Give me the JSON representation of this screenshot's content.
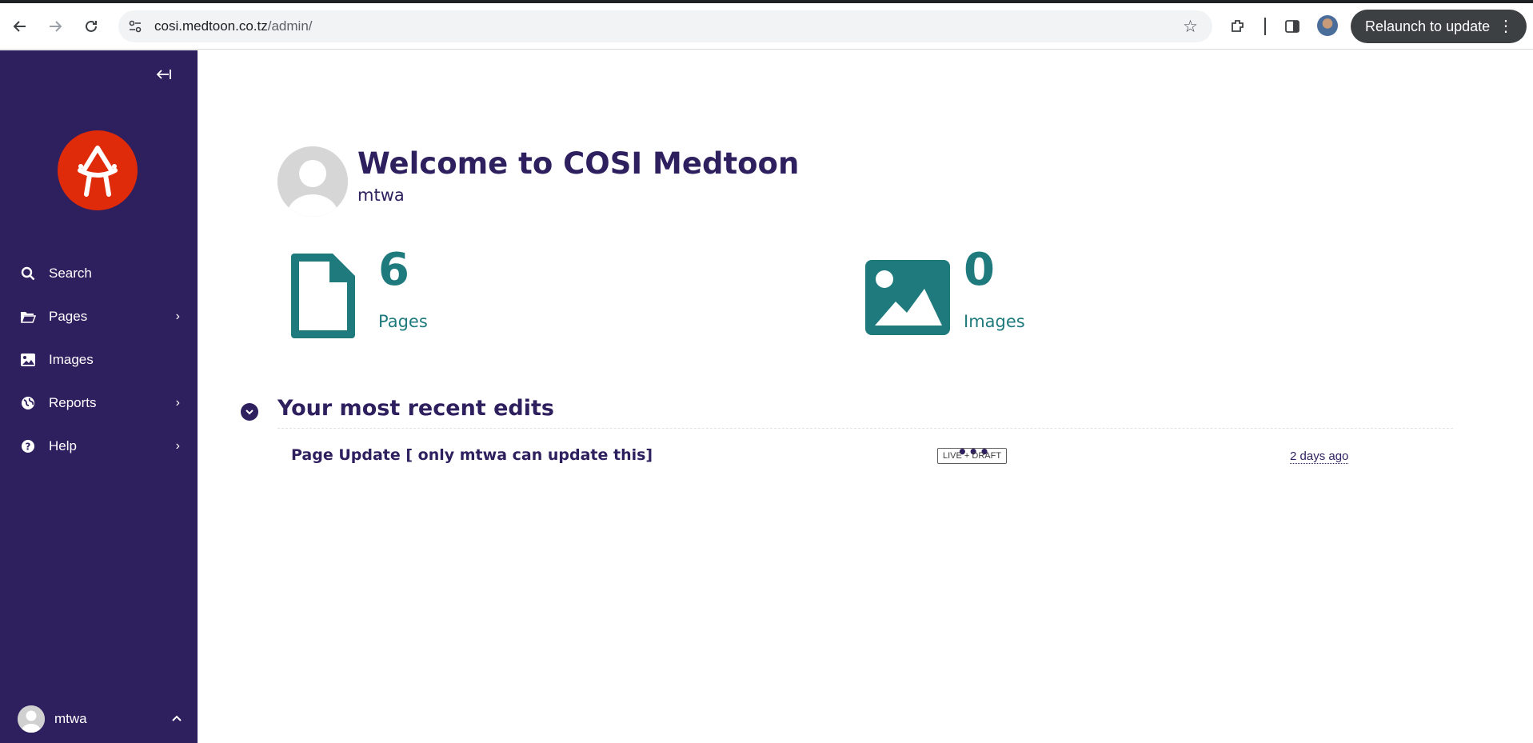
{
  "browser": {
    "url_host": "cosi.medtoon.co.tz",
    "url_path": "/admin/",
    "relaunch_label": "Relaunch to update",
    "icons": [
      "back-icon",
      "forward-icon",
      "reload-icon",
      "site-info-icon",
      "star-icon",
      "extensions-icon",
      "side-panel-icon",
      "profile-avatar",
      "menu-dots-icon"
    ]
  },
  "sidebar": {
    "collapse_icon": "collapse-icon",
    "logo": "wagtail-logo",
    "items": [
      {
        "label": "Search",
        "icon": "search-icon",
        "has_submenu": false
      },
      {
        "label": "Pages",
        "icon": "folder-open-icon",
        "has_submenu": true
      },
      {
        "label": "Images",
        "icon": "image-icon",
        "has_submenu": false
      },
      {
        "label": "Reports",
        "icon": "globe-icon",
        "has_submenu": true
      },
      {
        "label": "Help",
        "icon": "help-icon",
        "has_submenu": true
      }
    ],
    "user": {
      "name": "mtwa"
    }
  },
  "main": {
    "welcome_title": "Welcome to COSI Medtoon",
    "welcome_user": "mtwa",
    "stats": [
      {
        "value": "6",
        "label": "Pages",
        "icon": "document-icon"
      },
      {
        "value": "0",
        "label": "Images",
        "icon": "image-icon"
      }
    ],
    "recent_edits": {
      "title": "Your most recent edits",
      "rows": [
        {
          "title": "Page Update [ only mtwa can update this]",
          "more": "•••",
          "status": "LIVE + DRAFT",
          "time": "2 days ago"
        }
      ]
    },
    "colors": {
      "sidebar": "#2e1f5e",
      "accent_teal": "#1f7a7d",
      "logo_red": "#e02b0a"
    }
  }
}
